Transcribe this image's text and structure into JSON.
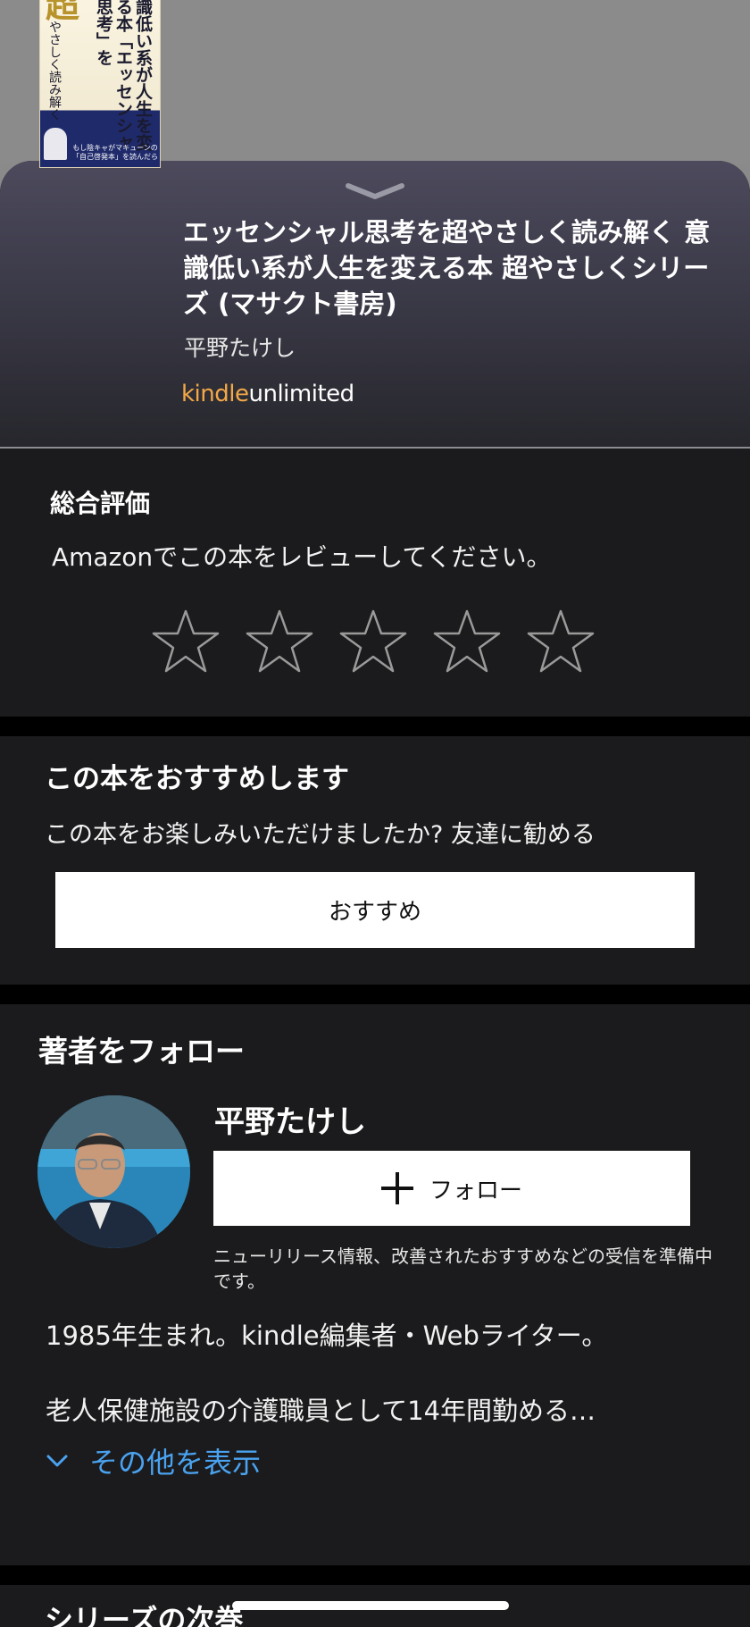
{
  "book": {
    "title": "エッセンシャル思考を超やさしく読み解く 意識低い系が人生を変える本 超やさしくシリーズ (マサクト書房)",
    "author": "平野たけし",
    "kindle_label": "kindle",
    "unlimited_label": "unlimited",
    "cover": {
      "top_text": "意識低い系が人生を変える本",
      "gold_text": "超",
      "main_text": "「エッセンシャル思考」を",
      "sub_text": "やさしく読み解く",
      "band_text": "もし陰キャがマキューンの「自己啓発本」を読んだら"
    }
  },
  "rating": {
    "title": "総合評価",
    "prompt": "Amazonでこの本をレビューしてください。",
    "star_count": 5
  },
  "recommend": {
    "title": "この本をおすすめします",
    "text": "この本をお楽しみいただけましたか? 友達に勧める",
    "button_label": "おすすめ"
  },
  "follow": {
    "title": "著者をフォロー",
    "author_name": "平野たけし",
    "button_label": "フォロー",
    "note": "ニューリリース情報、改善されたおすすめなどの受信を準備中です。",
    "bio_line1": "1985年生まれ。kindle編集者・Webライター。",
    "bio_line2": "老人保健施設の介護職員として14年間勤める…",
    "more_label": "その他を表示"
  },
  "series": {
    "title": "シリーズの次巻"
  },
  "colors": {
    "kindle_orange": "#f3a847",
    "link_blue": "#4aa3f0",
    "card_bg": "#1b1b1d"
  }
}
